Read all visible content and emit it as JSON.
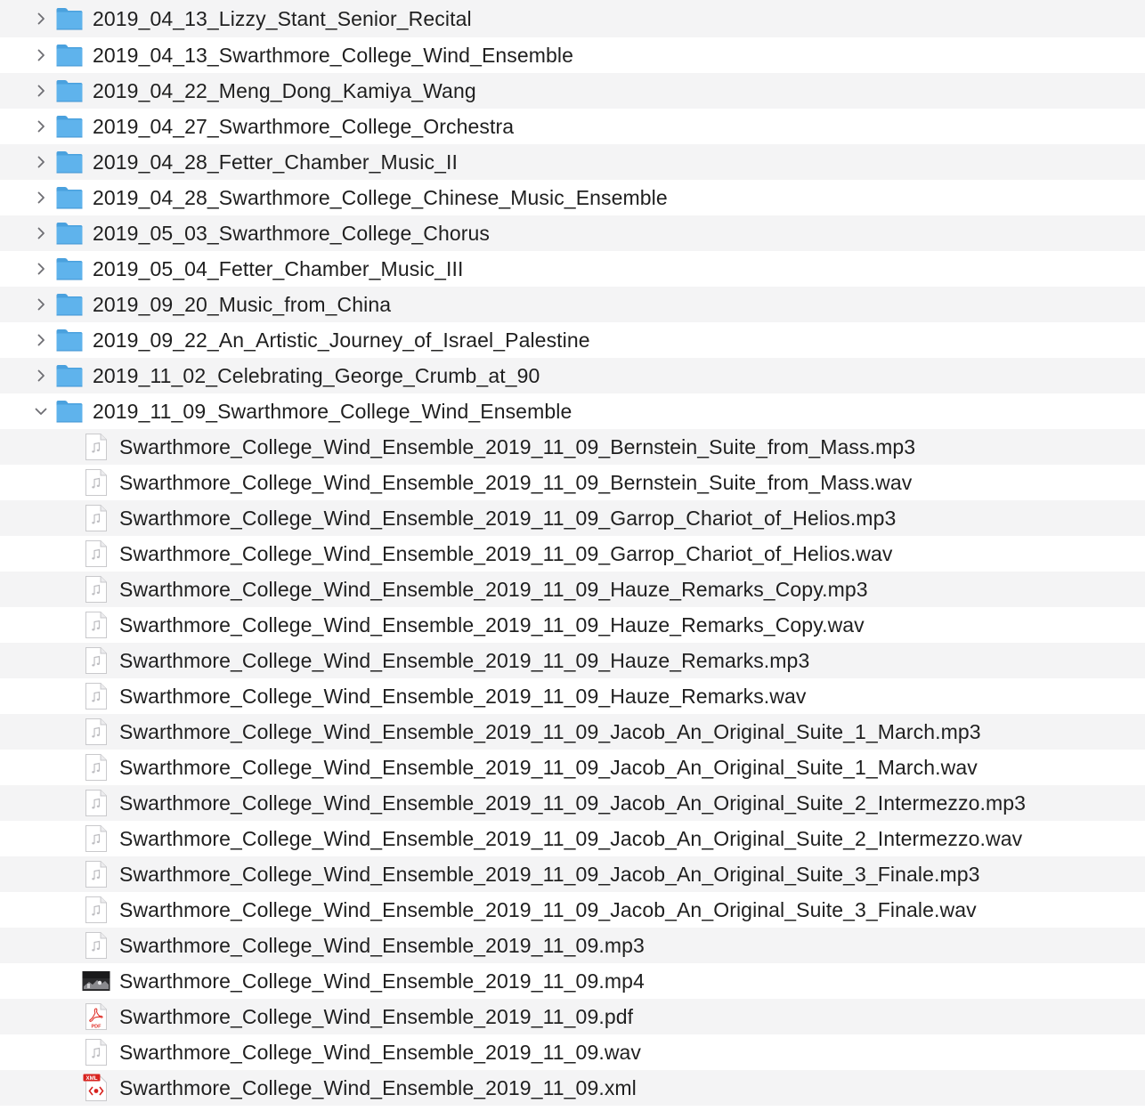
{
  "folders_before": [
    {
      "name": "2019_04_13_Lizzy_Stant_Senior_Recital",
      "expanded": false
    },
    {
      "name": "2019_04_13_Swarthmore_College_Wind_Ensemble",
      "expanded": false
    },
    {
      "name": "2019_04_22_Meng_Dong_Kamiya_Wang",
      "expanded": false
    },
    {
      "name": "2019_04_27_Swarthmore_College_Orchestra",
      "expanded": false
    },
    {
      "name": "2019_04_28_Fetter_Chamber_Music_II",
      "expanded": false
    },
    {
      "name": "2019_04_28_Swarthmore_College_Chinese_Music_Ensemble",
      "expanded": false
    },
    {
      "name": "2019_05_03_Swarthmore_College_Chorus",
      "expanded": false
    },
    {
      "name": "2019_05_04_Fetter_Chamber_Music_III",
      "expanded": false
    },
    {
      "name": "2019_09_20_Music_from_China",
      "expanded": false
    },
    {
      "name": "2019_09_22_An_Artistic_Journey_of_Israel_Palestine",
      "expanded": false
    },
    {
      "name": "2019_11_02_Celebrating_George_Crumb_at_90",
      "expanded": false
    }
  ],
  "open_folder": {
    "name": "2019_11_09_Swarthmore_College_Wind_Ensemble",
    "expanded": true,
    "files": [
      {
        "name": "Swarthmore_College_Wind_Ensemble_2019_11_09_Bernstein_Suite_from_Mass.mp3",
        "icon": "audio-file-icon"
      },
      {
        "name": "Swarthmore_College_Wind_Ensemble_2019_11_09_Bernstein_Suite_from_Mass.wav",
        "icon": "audio-file-icon"
      },
      {
        "name": "Swarthmore_College_Wind_Ensemble_2019_11_09_Garrop_Chariot_of_Helios.mp3",
        "icon": "audio-file-icon"
      },
      {
        "name": "Swarthmore_College_Wind_Ensemble_2019_11_09_Garrop_Chariot_of_Helios.wav",
        "icon": "audio-file-icon"
      },
      {
        "name": "Swarthmore_College_Wind_Ensemble_2019_11_09_Hauze_Remarks_Copy.mp3",
        "icon": "audio-file-icon"
      },
      {
        "name": "Swarthmore_College_Wind_Ensemble_2019_11_09_Hauze_Remarks_Copy.wav",
        "icon": "audio-file-icon"
      },
      {
        "name": "Swarthmore_College_Wind_Ensemble_2019_11_09_Hauze_Remarks.mp3",
        "icon": "audio-file-icon"
      },
      {
        "name": "Swarthmore_College_Wind_Ensemble_2019_11_09_Hauze_Remarks.wav",
        "icon": "audio-file-icon"
      },
      {
        "name": "Swarthmore_College_Wind_Ensemble_2019_11_09_Jacob_An_Original_Suite_1_March.mp3",
        "icon": "audio-file-icon"
      },
      {
        "name": "Swarthmore_College_Wind_Ensemble_2019_11_09_Jacob_An_Original_Suite_1_March.wav",
        "icon": "audio-file-icon"
      },
      {
        "name": "Swarthmore_College_Wind_Ensemble_2019_11_09_Jacob_An_Original_Suite_2_Intermezzo.mp3",
        "icon": "audio-file-icon"
      },
      {
        "name": "Swarthmore_College_Wind_Ensemble_2019_11_09_Jacob_An_Original_Suite_2_Intermezzo.wav",
        "icon": "audio-file-icon"
      },
      {
        "name": "Swarthmore_College_Wind_Ensemble_2019_11_09_Jacob_An_Original_Suite_3_Finale.mp3",
        "icon": "audio-file-icon"
      },
      {
        "name": "Swarthmore_College_Wind_Ensemble_2019_11_09_Jacob_An_Original_Suite_3_Finale.wav",
        "icon": "audio-file-icon"
      },
      {
        "name": "Swarthmore_College_Wind_Ensemble_2019_11_09.mp3",
        "icon": "audio-file-icon"
      },
      {
        "name": "Swarthmore_College_Wind_Ensemble_2019_11_09.mp4",
        "icon": "video-thumbnail-icon"
      },
      {
        "name": "Swarthmore_College_Wind_Ensemble_2019_11_09.pdf",
        "icon": "pdf-file-icon"
      },
      {
        "name": "Swarthmore_College_Wind_Ensemble_2019_11_09.wav",
        "icon": "audio-file-icon"
      },
      {
        "name": "Swarthmore_College_Wind_Ensemble_2019_11_09.xml",
        "icon": "xml-file-icon"
      }
    ]
  },
  "icon_labels": {
    "pdf": "PDF",
    "xml": "XML"
  },
  "colors": {
    "folder_fill": "#5fb3ec",
    "folder_tab": "#4aa1de",
    "stripe": "#f4f4f5",
    "chevron": "#6e6e73",
    "pdf_red": "#e0322b",
    "xml_red": "#d8231f"
  }
}
